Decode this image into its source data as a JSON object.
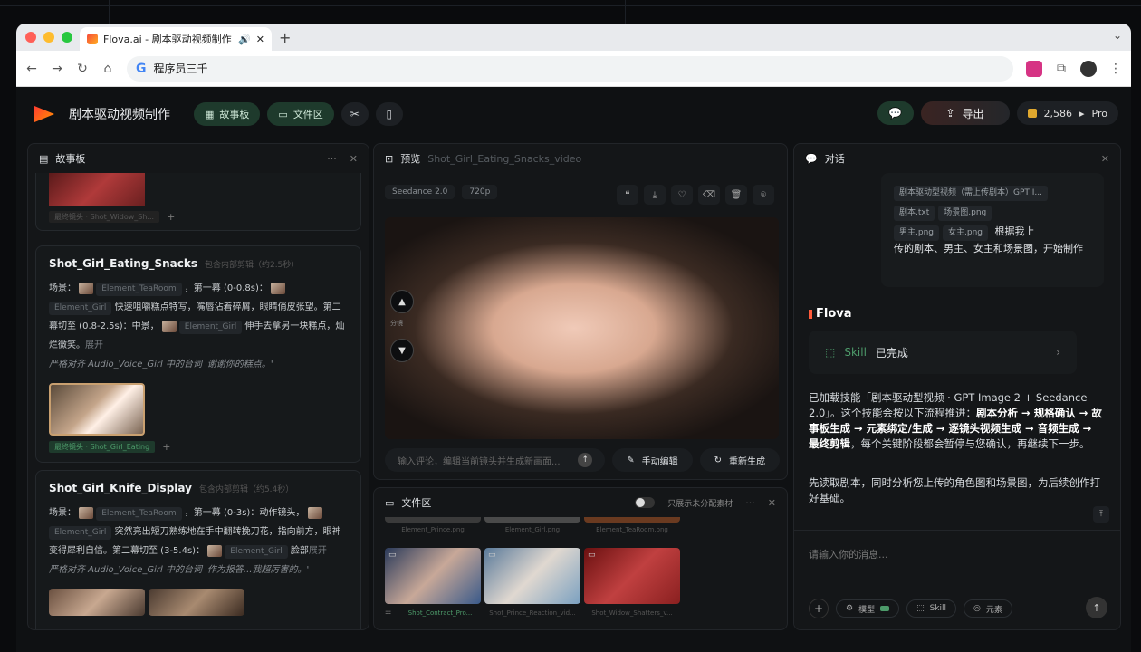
{
  "browser": {
    "tab_title": "Flova.ai - 剧本驱动视频制作",
    "address": "程序员三千",
    "dot_colors": [
      "#ff5f57",
      "#febc2e",
      "#28c840"
    ]
  },
  "app": {
    "title": "剧本驱动视频制作",
    "nav": {
      "storyboard": "故事板",
      "files": "文件区"
    },
    "export": "导出",
    "credits": "2,586",
    "plan": "Pro"
  },
  "storyboard": {
    "title": "故事板",
    "top_card": {
      "tag": "最终镜头 · Shot_Widow_Sh..."
    },
    "cards": [
      {
        "title": "Shot_Girl_Eating_Snacks",
        "meta": "包含内部剪辑（约2.5秒）",
        "p1": "场景：",
        "e1": "Element_TeaRoom",
        "p2": "，第一幕 (0-0.8s)：",
        "e2": "Element_Girl",
        "p3": "快速咀嚼糕点特写，嘴唇沾着碎屑，眼睛俏皮张望。第二幕切至 (0.8-2.5s)：中景，",
        "e3": "Element_Girl",
        "p4": "伸手去拿另一块糕点，灿烂微笑。",
        "more": "展开",
        "italic": "严格对齐 Audio_Voice_Girl 中的台词 '谢谢你的糕点。'",
        "clip_tag": "最终镜头 · Shot_Girl_Eating"
      },
      {
        "title": "Shot_Girl_Knife_Display",
        "meta": "包含内部剪辑（约5.4秒）",
        "p1": "场景：",
        "e1": "Element_TeaRoom",
        "p2": "，第一幕 (0-3s)：动作镜头，",
        "e2": "Element_Girl",
        "p3": "突然亮出短刀熟练地在手中翻转挽刀花，指向前方，眼神变得犀利自信。第二幕切至 (3-5.4s)：",
        "e3": "Element_Girl",
        "p4": "脸部",
        "more": "展开",
        "italic": "严格对齐 Audio_Voice_Girl 中的台词 '作为报答...我超厉害的。'"
      }
    ]
  },
  "preview": {
    "title": "预览",
    "file": "Shot_Girl_Eating_Snacks_video",
    "model": "Seedance 2.0",
    "resolution": "720p",
    "side_text": "分镜",
    "comment_placeholder": "输入评论，编辑当前镜头并生成新画面...",
    "manual_edit": "手动编辑",
    "regenerate": "重新生成"
  },
  "files": {
    "title": "文件区",
    "toggle_label": "只展示未分配素材",
    "top_labels": [
      "Element_Prince.png",
      "Element_Girl.png",
      "Element_TeaRoom.png"
    ],
    "items": [
      {
        "label": "Shot_Contract_Pro...",
        "color": "#3a5a8a"
      },
      {
        "label": "Shot_Prince_Reaction_vid...",
        "color": "#7aa0c0"
      },
      {
        "label": "Shot_Widow_Shatters_v...",
        "color": "#8a2020"
      }
    ]
  },
  "chat": {
    "title": "对话",
    "user_files": [
      "剧本驱动型视频（需上传剧本）GPT I...",
      "剧本.txt",
      "场景图.png",
      "男主.png",
      "女主.png"
    ],
    "user_text_a": "根据我上",
    "user_text_b": "传的剧本、男主、女主和场景图，开始制作",
    "brand": "Flova",
    "skill_label": "Skill",
    "skill_status": "已完成",
    "msg1_a": "已加载技能「剧本驱动型视频 · GPT Image 2 + Seedance 2.0」。这个技能会按以下流程推进：",
    "msg1_b": "剧本分析 → 规格确认 → 故事板生成 → 元素绑定/生成 → 逐镜头视频生成 → 音频生成 → 最终剪辑",
    "msg1_c": "，每个关键阶段都会暂停与您确认，再继续下一步。",
    "msg2": "先读取剧本，同时分析您上传的角色图和场景图，为后续创作打好基础。",
    "input_placeholder": "请输入你的消息...",
    "btn_model": "模型",
    "btn_skill": "Skill",
    "btn_element": "元素"
  }
}
